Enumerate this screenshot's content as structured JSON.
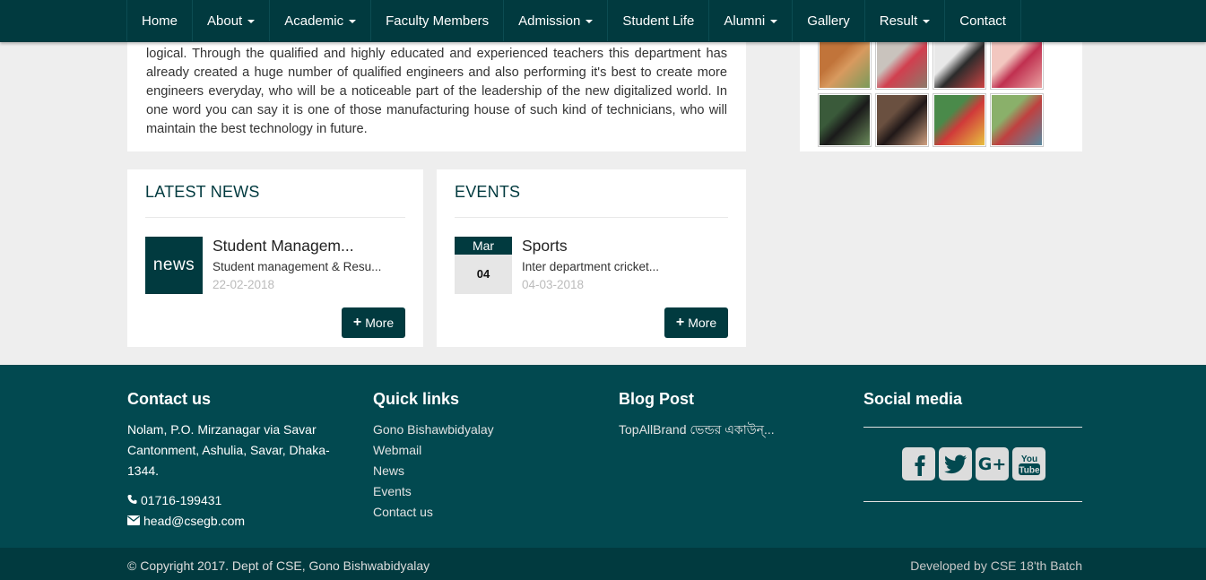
{
  "nav": {
    "items": [
      {
        "label": "Home",
        "dropdown": false
      },
      {
        "label": "About",
        "dropdown": true
      },
      {
        "label": "Academic",
        "dropdown": true
      },
      {
        "label": "Faculty Members",
        "dropdown": false
      },
      {
        "label": "Admission",
        "dropdown": true
      },
      {
        "label": "Student Life",
        "dropdown": false
      },
      {
        "label": "Alumni",
        "dropdown": true
      },
      {
        "label": "Gallery",
        "dropdown": false
      },
      {
        "label": "Result",
        "dropdown": true
      },
      {
        "label": "Contact",
        "dropdown": false
      }
    ]
  },
  "about": {
    "text": "logical. Through the qualified and highly educated and experienced teachers this department has already created a huge number of qualified engineers and also performing it's best to create more engineers everyday, who will be a noticeable part of the leadership of the new digitalized world. In one word you can say it is one of those manufacturing house of such kind of technicians, who will maintain the best technology in future."
  },
  "gallery": {
    "thumbs": [
      {
        "colors": [
          "#c1743a",
          "#d89a5f",
          "#7a9a5a"
        ]
      },
      {
        "colors": [
          "#c9c3bd",
          "#d13f4f",
          "#8c7a6a"
        ]
      },
      {
        "colors": [
          "#e8e8e8",
          "#2b2b2b",
          "#c44"
        ]
      },
      {
        "colors": [
          "#f2c7c0",
          "#c03050",
          "#e8a0a0"
        ]
      },
      {
        "colors": [
          "#3a5a3a",
          "#1a1a1a",
          "#6a8a5a"
        ]
      },
      {
        "colors": [
          "#6a5040",
          "#201818",
          "#d0a080"
        ]
      },
      {
        "colors": [
          "#4a8a4a",
          "#d03a3a",
          "#e8c040"
        ]
      },
      {
        "colors": [
          "#8ab06a",
          "#c04040",
          "#5a8aa0"
        ]
      }
    ]
  },
  "news": {
    "heading": "LATEST NEWS",
    "thumb_label": "news",
    "title": "Student Managem...",
    "description": "Student management & Resu...",
    "date": "22-02-2018",
    "more_label": "More"
  },
  "events": {
    "heading": "EVENTS",
    "month": "Mar",
    "day": "04",
    "title": "Sports",
    "description": "Inter department cricket...",
    "date": "04-03-2018",
    "more_label": "More"
  },
  "footer": {
    "contact": {
      "heading": "Contact us",
      "address": "Nolam, P.O. Mirzanagar via Savar Cantonment, Ashulia, Savar, Dhaka-1344.",
      "phone": "01716-199431",
      "email": "head@csegb.com"
    },
    "quick_links": {
      "heading": "Quick links",
      "links": [
        "Gono Bishawbidyalay",
        "Webmail",
        "News",
        "Events",
        "Contact us"
      ]
    },
    "blog": {
      "heading": "Blog Post",
      "post": "TopAllBrand ভেন্ডর একাউন্..."
    },
    "social": {
      "heading": "Social media",
      "icons": [
        "facebook-icon",
        "twitter-icon",
        "google-plus-icon",
        "youtube-icon"
      ]
    }
  },
  "copyright": {
    "left": "© Copyright 2017. Dept of CSE, Gono Bishwabidyalay",
    "right": "Developed by CSE 18'th Batch"
  },
  "colors": {
    "primary": "#013a3f",
    "footer": "#024950",
    "background": "#eeeeee"
  }
}
